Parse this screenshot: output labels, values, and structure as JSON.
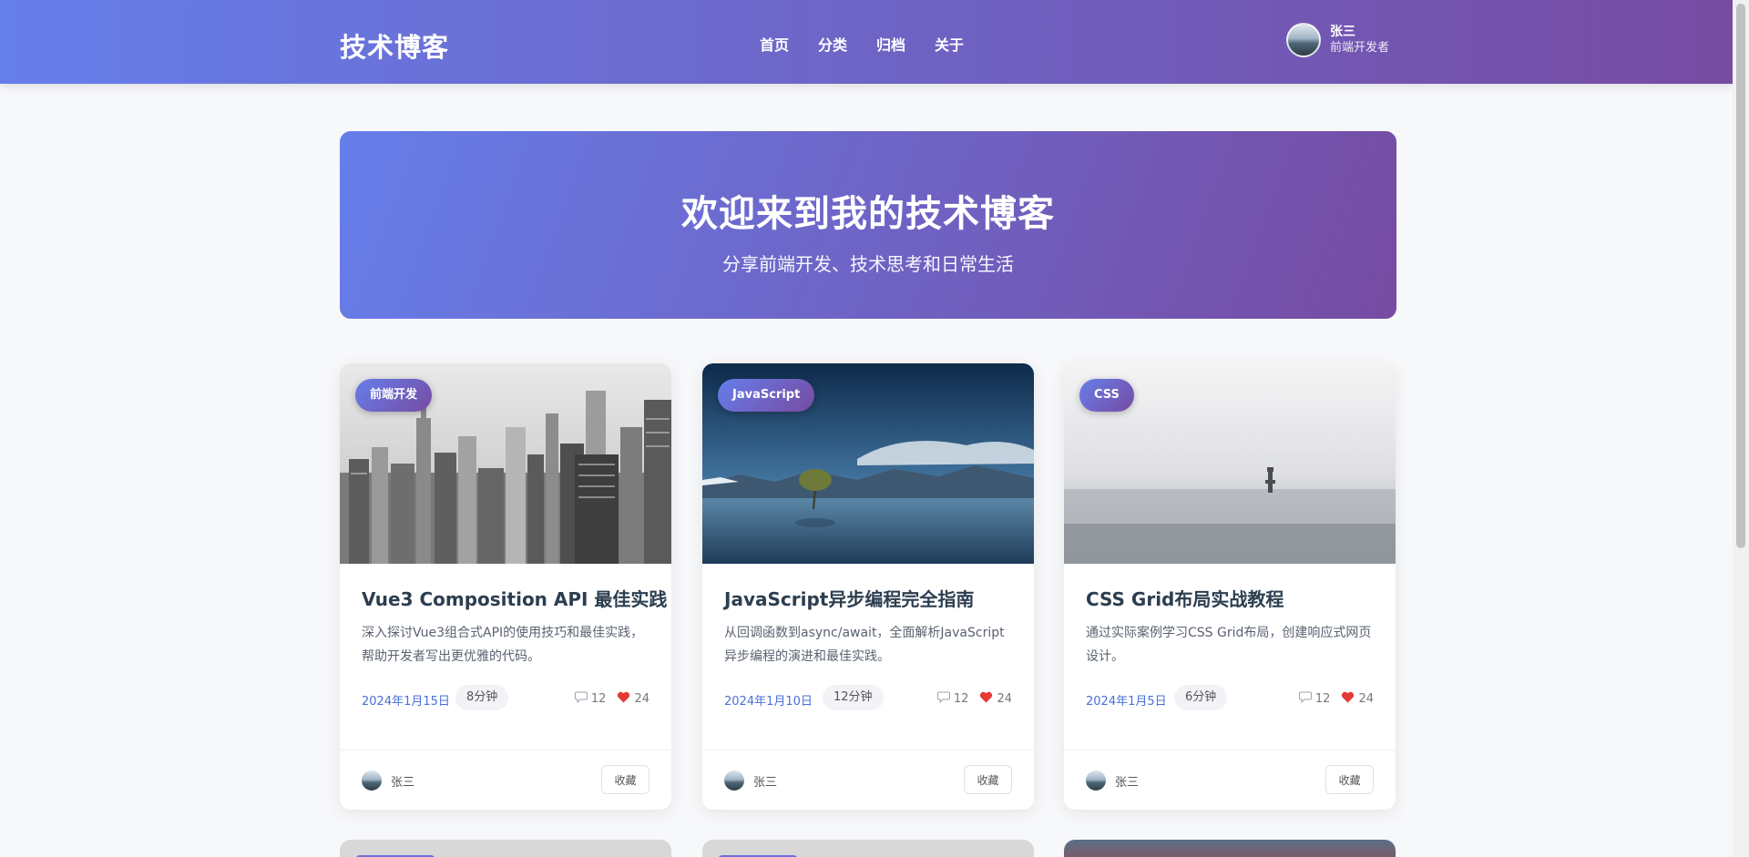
{
  "header": {
    "brand": "技术博客",
    "nav": [
      "首页",
      "分类",
      "归档",
      "关于"
    ],
    "user": {
      "name": "张三",
      "role": "前端开发者"
    }
  },
  "hero": {
    "title": "欢迎来到我的技术博客",
    "subtitle": "分享前端开发、技术思考和日常生活"
  },
  "posts": [
    {
      "tag": "前端开发",
      "title": "Vue3 Composition API 最佳实践",
      "excerpt": "深入探讨Vue3组合式API的使用技巧和最佳实践，帮助开发者写出更优雅的代码。",
      "date": "2024年1月15日",
      "read_time": "8分钟",
      "comments": "12",
      "likes": "24",
      "author": "张三",
      "favorite_label": "收藏"
    },
    {
      "tag": "JavaScript",
      "title": "JavaScript异步编程完全指南",
      "excerpt": "从回调函数到async/await，全面解析JavaScript异步编程的演进和最佳实践。",
      "date": "2024年1月10日",
      "read_time": "12分钟",
      "comments": "12",
      "likes": "24",
      "author": "张三",
      "favorite_label": "收藏"
    },
    {
      "tag": "CSS",
      "title": "CSS Grid布局实战教程",
      "excerpt": "通过实际案例学习CSS Grid布局，创建响应式网页设计。",
      "date": "2024年1月5日",
      "read_time": "6分钟",
      "comments": "12",
      "likes": "24",
      "author": "张三",
      "favorite_label": "收藏"
    }
  ],
  "icons": {
    "comment": "comment-icon",
    "like": "heart-icon"
  },
  "colors": {
    "gradient_start": "#667eea",
    "gradient_end": "#764ba2",
    "date": "#4a6fd8",
    "heart": "#e53935"
  }
}
